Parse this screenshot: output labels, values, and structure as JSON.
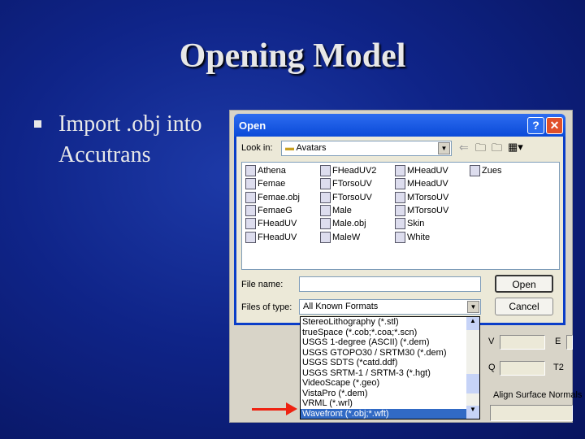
{
  "slide": {
    "title": "Opening Model",
    "bullet_text_1": "Import .obj into",
    "bullet_text_2": "Accutrans"
  },
  "dialog": {
    "title": "Open",
    "help": "?",
    "close": "✕",
    "look_in_label": "Look in:",
    "look_in_value": "Avatars",
    "files": [
      [
        "Athena",
        "FHeadUV2",
        "MHeadUV",
        "Zues"
      ],
      [
        "Femae",
        "FTorsoUV",
        "MHeadUV",
        ""
      ],
      [
        "Femae.obj",
        "FTorsoUV",
        "MTorsoUV",
        ""
      ],
      [
        "FemaeG",
        "Male",
        "MTorsoUV",
        ""
      ],
      [
        "FHeadUV",
        "Male.obj",
        "Skin",
        ""
      ],
      [
        "FHeadUV",
        "MaleW",
        "White",
        ""
      ]
    ],
    "file_name_label": "File name:",
    "file_name_value": "",
    "files_of_type_label": "Files of type:",
    "files_of_type_value": "All Known Formats",
    "open": "Open",
    "cancel": "Cancel",
    "type_options": [
      "StereoLithography (*.stl)",
      "trueSpace (*.cob;*.coa;*.scn)",
      "USGS 1-degree (ASCII) (*.dem)",
      "USGS GTOPO30 / SRTM30 (*.dem)",
      "USGS SDTS (*catd.ddf)",
      "USGS SRTM-1 / SRTM-3 (*.hgt)",
      "VideoScape (*.geo)",
      "VistaPro (*.dem)",
      "VRML (*.wrl)",
      "Wavefront (*.obj;*.wft)"
    ],
    "selected_index": 9
  },
  "app": {
    "v": "V",
    "e": "E",
    "q": "Q",
    "t2": "T2",
    "align": "Align Surface Normals"
  }
}
